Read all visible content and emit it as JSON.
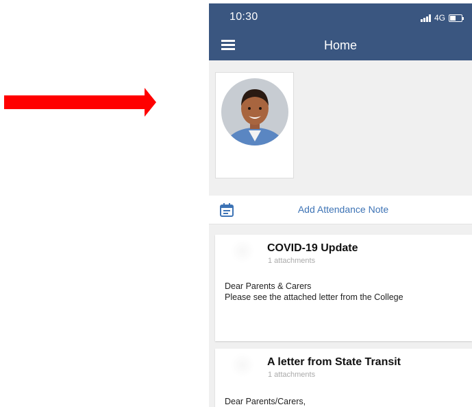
{
  "status_bar": {
    "time": "10:30",
    "network": "4G"
  },
  "nav": {
    "title": "Home"
  },
  "attendance": {
    "label": "Add Attendance Note"
  },
  "news": [
    {
      "title": "COVID-19 Update",
      "attachments": "1 attachments",
      "body_line1": "Dear Parents & Carers",
      "body_line2": "Please see the attached letter from the College"
    },
    {
      "title": "A letter from State Transit",
      "attachments": "1 attachments",
      "body_line1": "Dear Parents/Carers,"
    }
  ],
  "colors": {
    "header": "#3a5680",
    "accent": "#3d73b5",
    "arrow": "#ff0000",
    "background": "#f0f0f0"
  },
  "icons": [
    "red-arrow-icon",
    "hamburger-menu-icon",
    "calendar-icon",
    "signal-icon",
    "battery-icon"
  ]
}
